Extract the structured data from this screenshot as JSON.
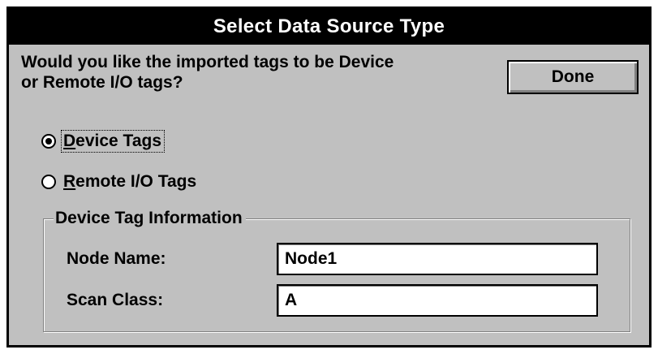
{
  "dialog": {
    "title": "Select Data Source Type",
    "prompt_line1": "Would you like the imported tags to be Device",
    "prompt_line2": "or Remote I/O tags?",
    "done_label": "Done"
  },
  "radios": [
    {
      "mnemonic": "D",
      "rest": "evice Tags",
      "checked": true,
      "focused": true
    },
    {
      "mnemonic": "R",
      "rest": "emote I/O Tags",
      "checked": false,
      "focused": false
    }
  ],
  "device_info": {
    "group_title": "Device Tag Information",
    "node_name_label": "Node Name:",
    "node_name_value": "Node1",
    "scan_class_label": "Scan Class:",
    "scan_class_value": "A"
  }
}
